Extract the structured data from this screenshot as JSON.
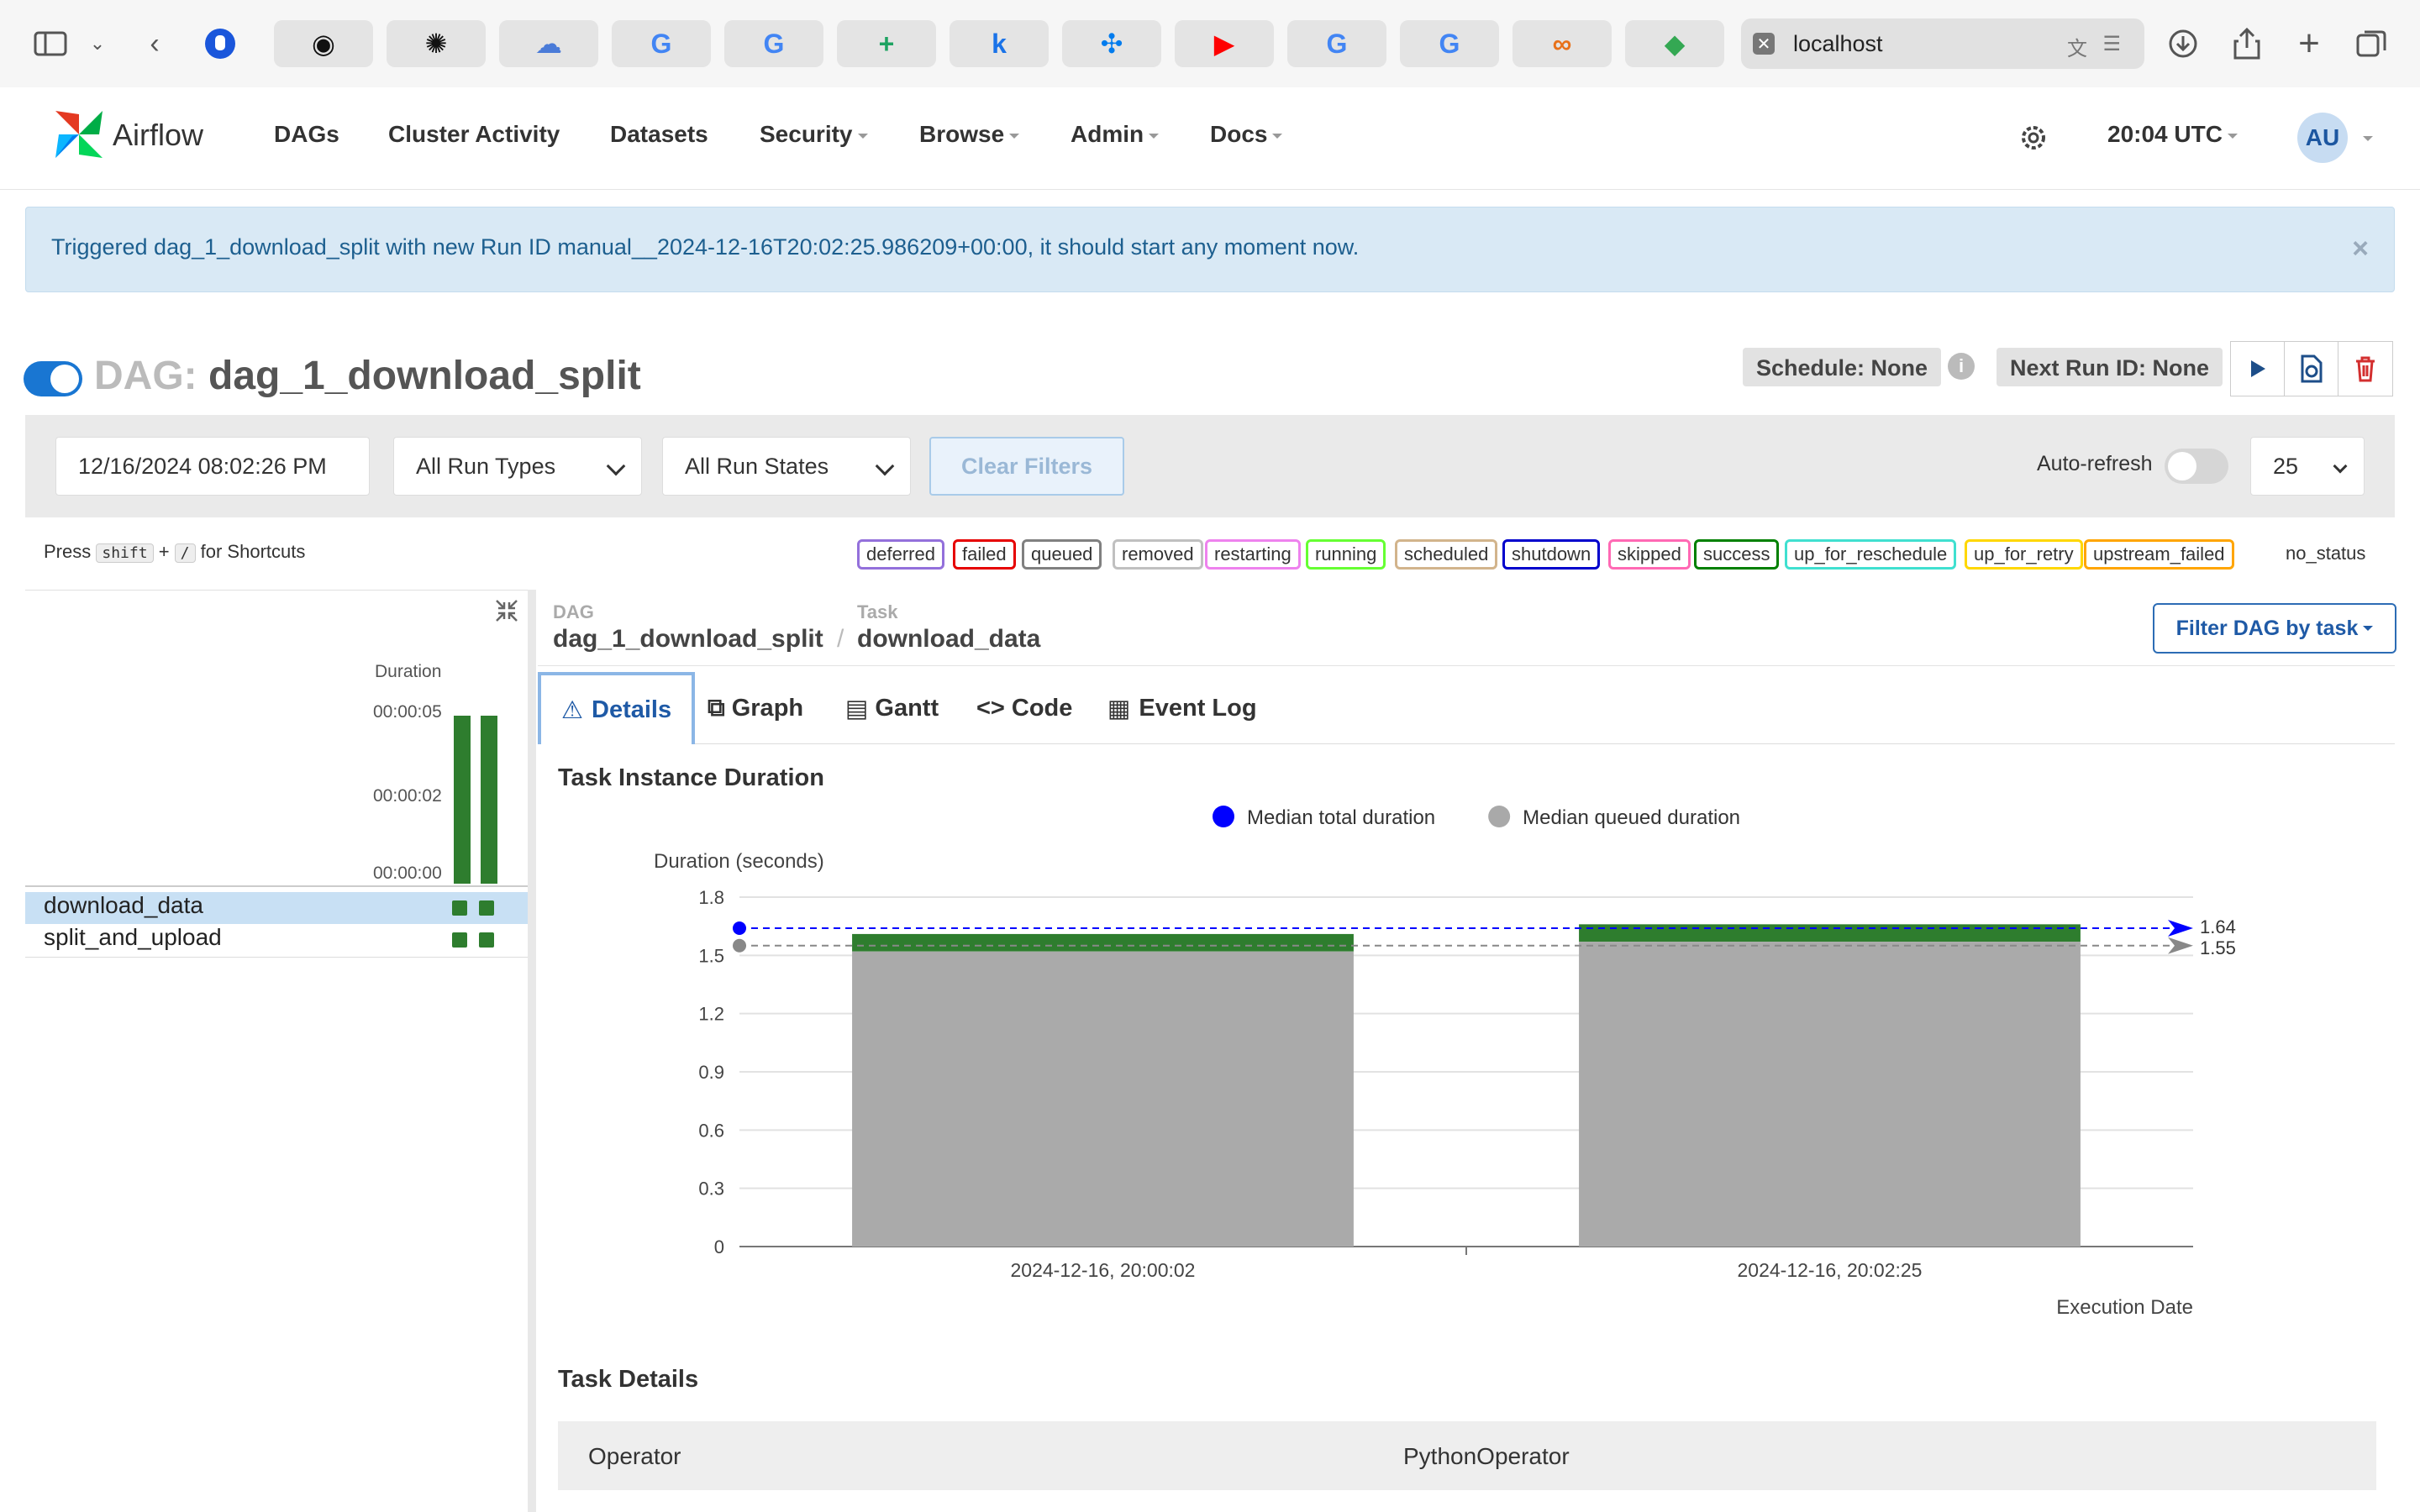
{
  "browser": {
    "url": "localhost",
    "tabs": [
      {
        "name": "github-icon",
        "glyph": "◉",
        "color": "#111111"
      },
      {
        "name": "openai-icon",
        "glyph": "✺",
        "color": "#111111"
      },
      {
        "name": "cloud-icon",
        "glyph": "☁",
        "color": "#4a7bd8"
      },
      {
        "name": "google-icon",
        "glyph": "G",
        "color": "#4285f4"
      },
      {
        "name": "google-icon",
        "glyph": "G",
        "color": "#4285f4"
      },
      {
        "name": "sheets-icon",
        "glyph": "+",
        "color": "#1ea362"
      },
      {
        "name": "k-icon",
        "glyph": "k",
        "color": "#1a73e8"
      },
      {
        "name": "airflow-icon",
        "glyph": "✣",
        "color": "#017cee"
      },
      {
        "name": "youtube-icon",
        "glyph": "▶",
        "color": "#ff0000"
      },
      {
        "name": "google-icon",
        "glyph": "G",
        "color": "#4285f4"
      },
      {
        "name": "google-icon",
        "glyph": "G",
        "color": "#4285f4"
      },
      {
        "name": "infinity-icon",
        "glyph": "∞",
        "color": "#e8711a"
      },
      {
        "name": "maps-icon",
        "glyph": "◆",
        "color": "#34a853"
      }
    ]
  },
  "nav": {
    "brand": "Airflow",
    "items": [
      "DAGs",
      "Cluster Activity",
      "Datasets",
      "Security",
      "Browse",
      "Admin",
      "Docs"
    ],
    "time": "20:04 UTC",
    "avatar": "AU"
  },
  "alert": "Triggered dag_1_download_split with new Run ID manual__2024-12-16T20:02:25.986209+00:00, it should start any moment now.",
  "dag": {
    "prefix": "DAG:",
    "name": "dag_1_download_split",
    "schedule": "Schedule: None",
    "next_run": "Next Run ID: None"
  },
  "filters": {
    "date": "12/16/2024  08:02:26 PM",
    "run_types": "All Run Types",
    "run_states": "All Run States",
    "clear": "Clear Filters",
    "auto_refresh": "Auto-refresh",
    "page_size": "25"
  },
  "shortcuts": {
    "press": "Press",
    "key1": "shift",
    "plus": "+",
    "key2": "/",
    "suffix": "for Shortcuts"
  },
  "states": [
    {
      "label": "deferred",
      "color": "#9370db"
    },
    {
      "label": "failed",
      "color": "#e60000"
    },
    {
      "label": "queued",
      "color": "#808080"
    },
    {
      "label": "removed",
      "color": "#c0c0c0"
    },
    {
      "label": "restarting",
      "color": "#ee82ee"
    },
    {
      "label": "running",
      "color": "#66ff33"
    },
    {
      "label": "scheduled",
      "color": "#d2b48c"
    },
    {
      "label": "shutdown",
      "color": "#0000cc"
    },
    {
      "label": "skipped",
      "color": "#ff69b4"
    },
    {
      "label": "success",
      "color": "#008000"
    },
    {
      "label": "up_for_reschedule",
      "color": "#40e0d0"
    },
    {
      "label": "up_for_retry",
      "color": "#ffd700"
    },
    {
      "label": "upstream_failed",
      "color": "#ffa500"
    }
  ],
  "no_status": "no_status",
  "grid": {
    "duration_label": "Duration",
    "ticks": [
      "00:00:05",
      "00:00:02",
      "00:00:00"
    ],
    "tasks": [
      "download_data",
      "split_and_upload"
    ]
  },
  "breadcrumb": {
    "dag_label": "DAG",
    "dag_value": "dag_1_download_split",
    "task_label": "Task",
    "task_value": "download_data",
    "filter_button": "Filter DAG by task"
  },
  "tabs": [
    "Details",
    "Graph",
    "Gantt",
    "Code",
    "Event Log"
  ],
  "section_title": "Task Instance Duration",
  "chart_data": {
    "type": "bar",
    "title": "Task Instance Duration",
    "ylabel": "Duration (seconds)",
    "xlabel": "Execution Date",
    "ylim": [
      0,
      1.8
    ],
    "yticks": [
      "0",
      "0.3",
      "0.6",
      "0.9",
      "1.2",
      "1.5",
      "1.8"
    ],
    "categories": [
      "2024-12-16, 20:00:02",
      "2024-12-16, 20:02:25"
    ],
    "series": [
      {
        "name": "Median queued duration",
        "values": [
          1.52,
          1.57
        ],
        "color": "#aaaaaa"
      },
      {
        "name": "Median total duration",
        "values": [
          1.61,
          1.66
        ],
        "color": "#2e7d2e"
      }
    ],
    "markers": [
      {
        "series": "Median total duration",
        "value": 1.64,
        "label": "1.64",
        "color": "#0000ff"
      },
      {
        "series": "Median queued duration",
        "value": 1.55,
        "label": "1.55",
        "color": "#888888"
      }
    ],
    "legend_position": "top"
  },
  "task_details": {
    "title": "Task Details",
    "rows": [
      {
        "key": "Operator",
        "value": "PythonOperator"
      }
    ]
  }
}
